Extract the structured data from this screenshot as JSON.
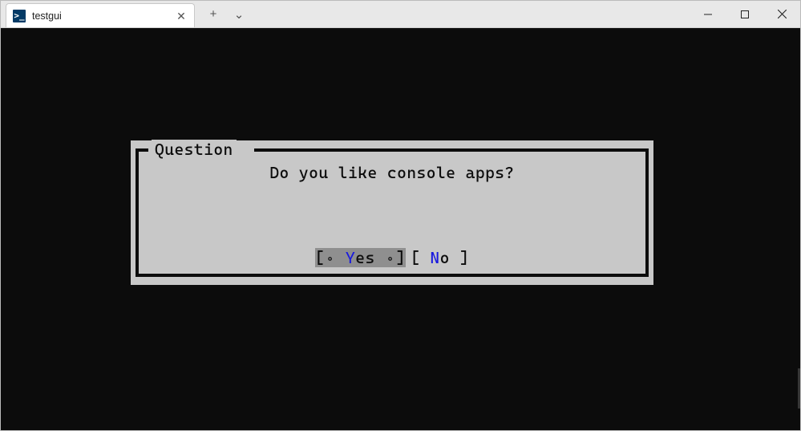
{
  "window": {
    "tab_title": "testgui",
    "tab_icon_glyph": ">_",
    "new_tab_glyph": "+",
    "tab_dropdown_glyph": "⌄"
  },
  "dialog": {
    "title": "Question",
    "message": "Do you like console apps?",
    "buttons": [
      {
        "label": "Yes",
        "hotkey": "Y",
        "rest": "es",
        "focused": true
      },
      {
        "label": "No",
        "hotkey": "N",
        "rest": "o",
        "focused": false
      }
    ]
  },
  "colors": {
    "terminal_bg": "#0c0c0c",
    "dialog_bg": "#c8c8c8",
    "focus_bg": "#8f8f8f",
    "hotkey": "#1919df"
  }
}
